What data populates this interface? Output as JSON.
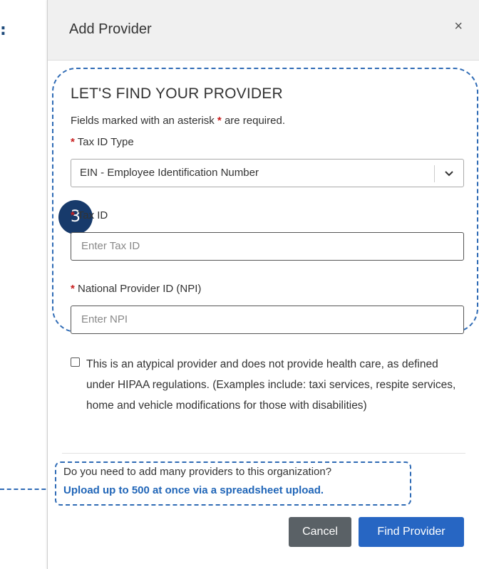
{
  "left_marker": ":",
  "modal": {
    "title": "Add Provider",
    "close_glyph": "×"
  },
  "section": {
    "title": "LET'S FIND YOUR PROVIDER",
    "required_note_pre": "Fields marked with an asterisk",
    "required_note_post": "are required.",
    "asterisk": "*"
  },
  "step_badge": "3",
  "fields": {
    "tax_id_type": {
      "label": "Tax ID Type",
      "value": "EIN - Employee Identification Number"
    },
    "tax_id": {
      "label": "Tax ID",
      "placeholder": "Enter Tax ID"
    },
    "npi": {
      "label": "National Provider ID (NPI)",
      "placeholder": "Enter NPI"
    }
  },
  "atypical": {
    "checked": false,
    "text": "This is an atypical provider and does not provide health care, as defined under HIPAA regulations. (Examples include: taxi services, respite services, home and vehicle modifications for those with disabilities)"
  },
  "bulk": {
    "question": "Do you need to add many providers to this organization?",
    "link": "Upload up to 500 at once via a spreadsheet upload."
  },
  "buttons": {
    "cancel": "Cancel",
    "find": "Find Provider"
  },
  "colors": {
    "accent_dash": "#2f6bb5",
    "badge": "#173a6b",
    "required": "#c81e1e",
    "primary_button": "#2766c3",
    "secondary_button": "#5a6166",
    "link": "#2166b8"
  },
  "icons": {
    "close": "close-icon",
    "dropdown": "chevron-down-icon",
    "checkbox": "checkbox-icon"
  }
}
